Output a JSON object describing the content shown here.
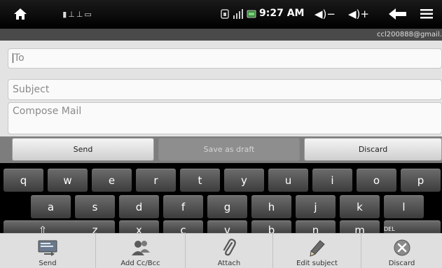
{
  "statusbar": {
    "notifications": "▮⊥⊥▭",
    "time": "9:27 AM",
    "volume_down": "◀)−",
    "volume_up": "◀)+"
  },
  "account": {
    "email": "ccl200888@gmail.com"
  },
  "compose": {
    "to_placeholder": "To",
    "subject_placeholder": "Subject",
    "body_placeholder": "Compose Mail"
  },
  "actions": {
    "send": "Send",
    "save_draft": "Save as draft",
    "discard": "Discard"
  },
  "keyboard": {
    "row1": [
      "q",
      "w",
      "e",
      "r",
      "t",
      "y",
      "u",
      "i",
      "o",
      "p"
    ],
    "row2": [
      "a",
      "s",
      "d",
      "f",
      "g",
      "h",
      "j",
      "k",
      "l"
    ],
    "row3": [
      "⇧",
      "z",
      "x",
      "c",
      "v",
      "b",
      "n",
      "m"
    ],
    "del_label": "DEL"
  },
  "menu": [
    {
      "label": "Send",
      "icon": "send-icon"
    },
    {
      "label": "Add Cc/Bcc",
      "icon": "contacts-icon"
    },
    {
      "label": "Attach",
      "icon": "paperclip-icon"
    },
    {
      "label": "Edit subject",
      "icon": "pencil-icon"
    },
    {
      "label": "Discard",
      "icon": "discard-icon"
    }
  ]
}
